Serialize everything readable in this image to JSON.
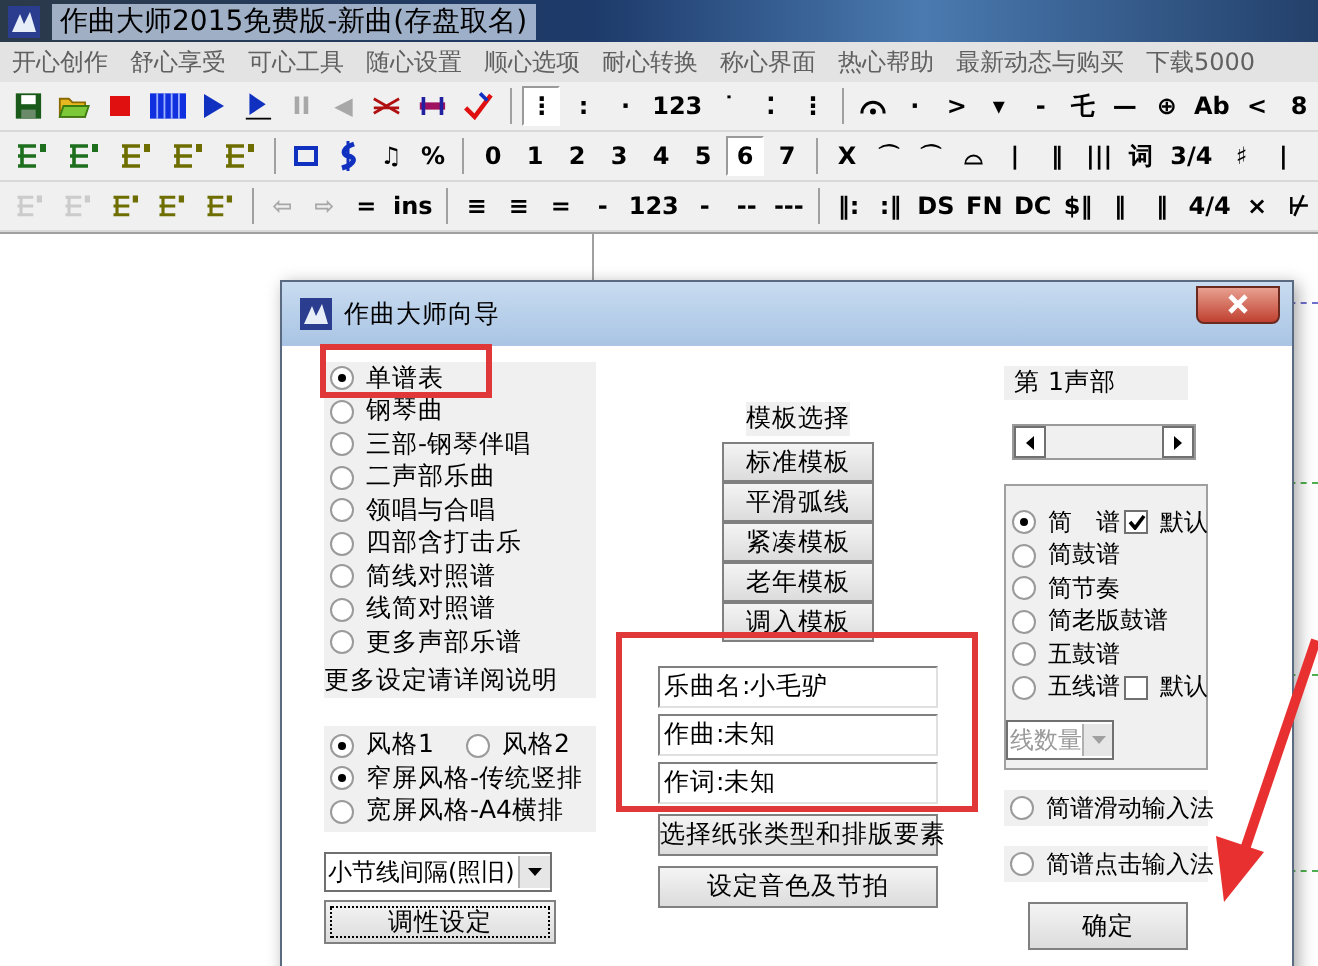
{
  "window": {
    "title": "作曲大师2015免费版-新曲(存盘取名)"
  },
  "menu": [
    "开心创作",
    "舒心享受",
    "可心工具",
    "随心设置",
    "顺心选项",
    "耐心转换",
    "称心界面",
    "热心帮助",
    "最新动态与购买",
    "下载5000"
  ],
  "toolbars": [
    [
      {
        "kind": "icon",
        "selected": false,
        "disabled": false
      },
      {
        "kind": "icon",
        "selected": false,
        "disabled": false
      },
      {
        "kind": "icon",
        "selected": false,
        "disabled": false
      },
      {
        "kind": "icon",
        "selected": false,
        "disabled": false
      },
      {
        "kind": "icon",
        "selected": false,
        "disabled": false
      },
      {
        "kind": "icon",
        "selected": false,
        "disabled": false
      },
      {
        "kind": "text",
        "label": "II",
        "selected": false,
        "disabled": true
      },
      {
        "kind": "text",
        "label": "◀",
        "selected": false,
        "disabled": true
      },
      {
        "kind": "icon",
        "selected": false,
        "disabled": false
      },
      {
        "kind": "icon",
        "selected": false,
        "disabled": false
      },
      {
        "kind": "icon",
        "selected": false,
        "disabled": false
      },
      {
        "kind": "separator"
      },
      {
        "kind": "text",
        "label": "⋮",
        "selected": true,
        "disabled": false
      },
      {
        "kind": "text",
        "label": ":",
        "selected": false,
        "disabled": false
      },
      {
        "kind": "text",
        "label": "·",
        "selected": false,
        "disabled": false
      },
      {
        "kind": "text",
        "label": "123",
        "selected": false,
        "disabled": false
      },
      {
        "kind": "text",
        "label": "˙",
        "selected": false,
        "disabled": false
      },
      {
        "kind": "text",
        "label": "⁚",
        "selected": false,
        "disabled": false
      },
      {
        "kind": "text",
        "label": "⋮",
        "selected": false,
        "disabled": false
      },
      {
        "kind": "separator"
      },
      {
        "kind": "icon",
        "selected": false,
        "disabled": false
      },
      {
        "kind": "text",
        "label": "·",
        "selected": false,
        "disabled": false
      },
      {
        "kind": "text",
        "label": ">",
        "selected": false,
        "disabled": false
      },
      {
        "kind": "text",
        "label": "▾",
        "selected": false,
        "disabled": false
      },
      {
        "kind": "text",
        "label": "-",
        "selected": false,
        "disabled": false
      },
      {
        "kind": "text",
        "label": "乇",
        "selected": false,
        "disabled": false
      },
      {
        "kind": "text",
        "label": "—",
        "selected": false,
        "disabled": false
      },
      {
        "kind": "text",
        "label": "⊕",
        "selected": false,
        "disabled": false
      },
      {
        "kind": "text",
        "label": "Ab",
        "selected": false,
        "disabled": false
      },
      {
        "kind": "text",
        "label": "<",
        "selected": false,
        "disabled": false
      },
      {
        "kind": "text",
        "label": "8",
        "selected": false,
        "disabled": false
      }
    ],
    [
      {
        "kind": "icon",
        "selected": false,
        "disabled": false
      },
      {
        "kind": "icon",
        "selected": false,
        "disabled": false
      },
      {
        "kind": "icon",
        "selected": false,
        "disabled": false
      },
      {
        "kind": "icon",
        "selected": false,
        "disabled": false
      },
      {
        "kind": "icon",
        "selected": false,
        "disabled": false
      },
      {
        "kind": "separator"
      },
      {
        "kind": "icon",
        "selected": false,
        "disabled": false
      },
      {
        "kind": "icon",
        "selected": false,
        "disabled": false
      },
      {
        "kind": "text",
        "label": "♫",
        "selected": false,
        "disabled": false
      },
      {
        "kind": "text",
        "label": "%",
        "selected": false,
        "disabled": false
      },
      {
        "kind": "separator"
      },
      {
        "kind": "text",
        "label": "0",
        "selected": false,
        "disabled": false
      },
      {
        "kind": "text",
        "label": "1",
        "selected": false,
        "disabled": false
      },
      {
        "kind": "text",
        "label": "2",
        "selected": false,
        "disabled": false
      },
      {
        "kind": "text",
        "label": "3",
        "selected": false,
        "disabled": false
      },
      {
        "kind": "text",
        "label": "4",
        "selected": false,
        "disabled": false
      },
      {
        "kind": "text",
        "label": "5",
        "selected": false,
        "disabled": false
      },
      {
        "kind": "text",
        "label": "6",
        "selected": true,
        "disabled": false
      },
      {
        "kind": "text",
        "label": "7",
        "selected": false,
        "disabled": false
      },
      {
        "kind": "separator"
      },
      {
        "kind": "text",
        "label": "X",
        "selected": false,
        "disabled": false
      },
      {
        "kind": "text",
        "label": "⌒",
        "selected": false,
        "disabled": false
      },
      {
        "kind": "text",
        "label": "⌒",
        "selected": false,
        "disabled": false
      },
      {
        "kind": "text",
        "label": "⌓",
        "selected": false,
        "disabled": false
      },
      {
        "kind": "text",
        "label": "|",
        "selected": false,
        "disabled": false
      },
      {
        "kind": "text",
        "label": "‖",
        "selected": false,
        "disabled": false
      },
      {
        "kind": "text",
        "label": "|||",
        "selected": false,
        "disabled": false
      },
      {
        "kind": "text",
        "label": "词",
        "selected": false,
        "disabled": false
      },
      {
        "kind": "text",
        "label": "3/4",
        "selected": false,
        "disabled": false
      },
      {
        "kind": "text",
        "label": "♯",
        "selected": false,
        "disabled": false
      },
      {
        "kind": "text",
        "label": "|",
        "selected": false,
        "disabled": false
      }
    ],
    [
      {
        "kind": "icon",
        "selected": false,
        "disabled": true
      },
      {
        "kind": "icon",
        "selected": false,
        "disabled": true
      },
      {
        "kind": "icon",
        "selected": false,
        "disabled": false
      },
      {
        "kind": "icon",
        "selected": false,
        "disabled": false
      },
      {
        "kind": "icon",
        "selected": false,
        "disabled": false
      },
      {
        "kind": "separator"
      },
      {
        "kind": "text",
        "label": "⇦",
        "selected": false,
        "disabled": true
      },
      {
        "kind": "text",
        "label": "⇨",
        "selected": false,
        "disabled": true
      },
      {
        "kind": "text",
        "label": "=",
        "selected": false,
        "disabled": false
      },
      {
        "kind": "text",
        "label": "ins",
        "selected": false,
        "disabled": false
      },
      {
        "kind": "separator"
      },
      {
        "kind": "text",
        "label": "≡",
        "selected": false,
        "disabled": false
      },
      {
        "kind": "text",
        "label": "≡",
        "selected": false,
        "disabled": false
      },
      {
        "kind": "text",
        "label": "=",
        "selected": false,
        "disabled": false
      },
      {
        "kind": "text",
        "label": "-",
        "selected": false,
        "disabled": false
      },
      {
        "kind": "text",
        "label": "123",
        "selected": false,
        "disabled": false
      },
      {
        "kind": "text",
        "label": "-",
        "selected": false,
        "disabled": false
      },
      {
        "kind": "text",
        "label": "--",
        "selected": false,
        "disabled": false
      },
      {
        "kind": "text",
        "label": "---",
        "selected": false,
        "disabled": false
      },
      {
        "kind": "separator"
      },
      {
        "kind": "text",
        "label": "‖:",
        "selected": false,
        "disabled": false
      },
      {
        "kind": "text",
        "label": ":‖",
        "selected": false,
        "disabled": false
      },
      {
        "kind": "text",
        "label": "DS",
        "selected": false,
        "disabled": false
      },
      {
        "kind": "text",
        "label": "FN",
        "selected": false,
        "disabled": false
      },
      {
        "kind": "text",
        "label": "DC",
        "selected": false,
        "disabled": false
      },
      {
        "kind": "text",
        "label": "$‖",
        "selected": false,
        "disabled": false
      },
      {
        "kind": "text",
        "label": "‖",
        "selected": false,
        "disabled": false
      },
      {
        "kind": "text",
        "label": "‖",
        "selected": false,
        "disabled": false
      },
      {
        "kind": "text",
        "label": "4/4",
        "selected": false,
        "disabled": false
      },
      {
        "kind": "text",
        "label": "×",
        "selected": false,
        "disabled": false
      },
      {
        "kind": "text",
        "label": "⊬",
        "selected": false,
        "disabled": false
      }
    ]
  ],
  "dialog": {
    "title": "作曲大师向导",
    "score_types": [
      {
        "label": "单谱表",
        "selected": true
      },
      {
        "label": "钢琴曲",
        "selected": false
      },
      {
        "label": "三部-钢琴伴唱",
        "selected": false
      },
      {
        "label": "二声部乐曲",
        "selected": false
      },
      {
        "label": "领唱与合唱",
        "selected": false
      },
      {
        "label": "四部含打击乐",
        "selected": false
      },
      {
        "label": "简线对照谱",
        "selected": false
      },
      {
        "label": "线简对照谱",
        "selected": false
      },
      {
        "label": "更多声部乐谱",
        "selected": false
      }
    ],
    "more_settings_note": "更多设定请详阅说明",
    "style_options": [
      {
        "label": "风格1",
        "selected": true
      },
      {
        "label": "风格2",
        "selected": false
      }
    ],
    "layout_options": [
      {
        "label": "窄屏风格-传统竖排",
        "selected": true
      },
      {
        "label": "宽屏风格-A4横排",
        "selected": false
      }
    ],
    "bar_spacing_dropdown": "小节线间隔(照旧)",
    "key_button": "调性设定",
    "template_heading": "模板选择",
    "template_buttons": [
      "标准模板",
      "平滑弧线",
      "紧凑模板",
      "老年模板",
      "调入模板"
    ],
    "fields": [
      {
        "value": "乐曲名:小毛驴"
      },
      {
        "value": "作曲:未知"
      },
      {
        "value": "作词:未知"
      }
    ],
    "paper_button": "选择纸张类型和排版要素",
    "tone_button": "设定音色及节拍",
    "voice_part_label": "第 1声部",
    "notation_options": [
      {
        "label": "简　谱",
        "selected": true,
        "default_checkbox": {
          "label": "默认",
          "checked": true
        }
      },
      {
        "label": "简鼓谱",
        "selected": false
      },
      {
        "label": "简节奏",
        "selected": false
      },
      {
        "label": "简老版鼓谱",
        "selected": false
      },
      {
        "label": "五鼓谱",
        "selected": false
      },
      {
        "label": "五线谱",
        "selected": false,
        "default_checkbox": {
          "label": "默认",
          "checked": false
        }
      }
    ],
    "line_count_dropdown": {
      "value": "线数量",
      "disabled": true
    },
    "input_methods": [
      {
        "label": "简谱滑动输入法",
        "selected": false
      },
      {
        "label": "简谱点击输入法",
        "selected": false
      }
    ],
    "ok_button": "确定"
  }
}
